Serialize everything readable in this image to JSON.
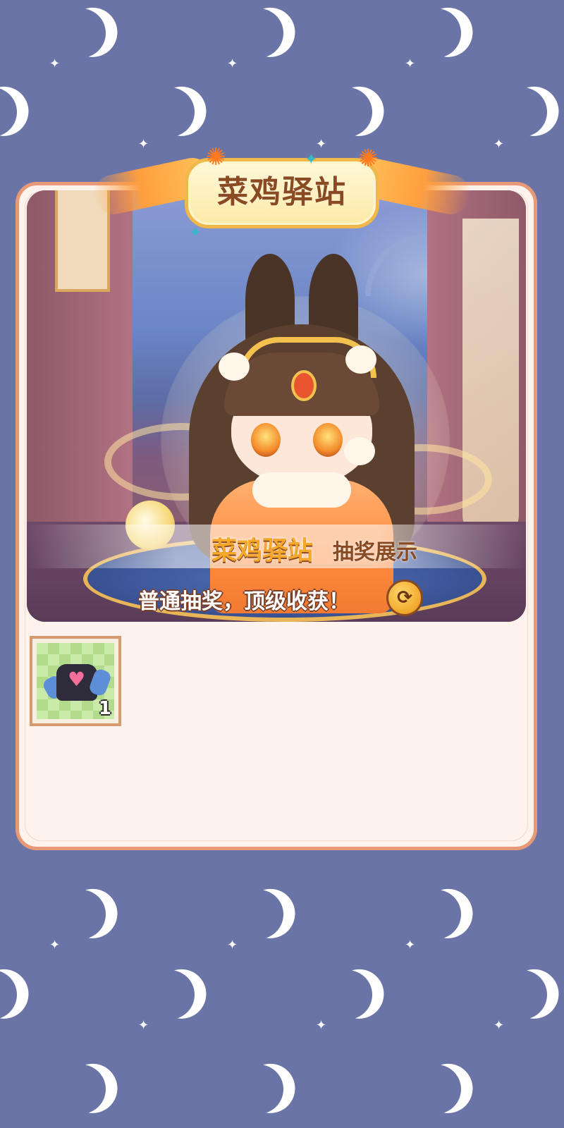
{
  "header": {
    "title": "菜鸡驿站"
  },
  "banner": {
    "brand": "菜鸡驿站",
    "subtitle": "抽奖展示",
    "slogan": "普通抽奖，顶级收获！",
    "refresh_icon": "refresh-icon"
  },
  "items": [
    {
      "name": "black-sweater-with-heart",
      "count": "1"
    }
  ],
  "colors": {
    "background": "#6b74a6",
    "panel": "#fdf2ec",
    "panel_border": "#e79a78",
    "accent_gold": "#f6a82a",
    "title_text": "#8a4a22"
  }
}
